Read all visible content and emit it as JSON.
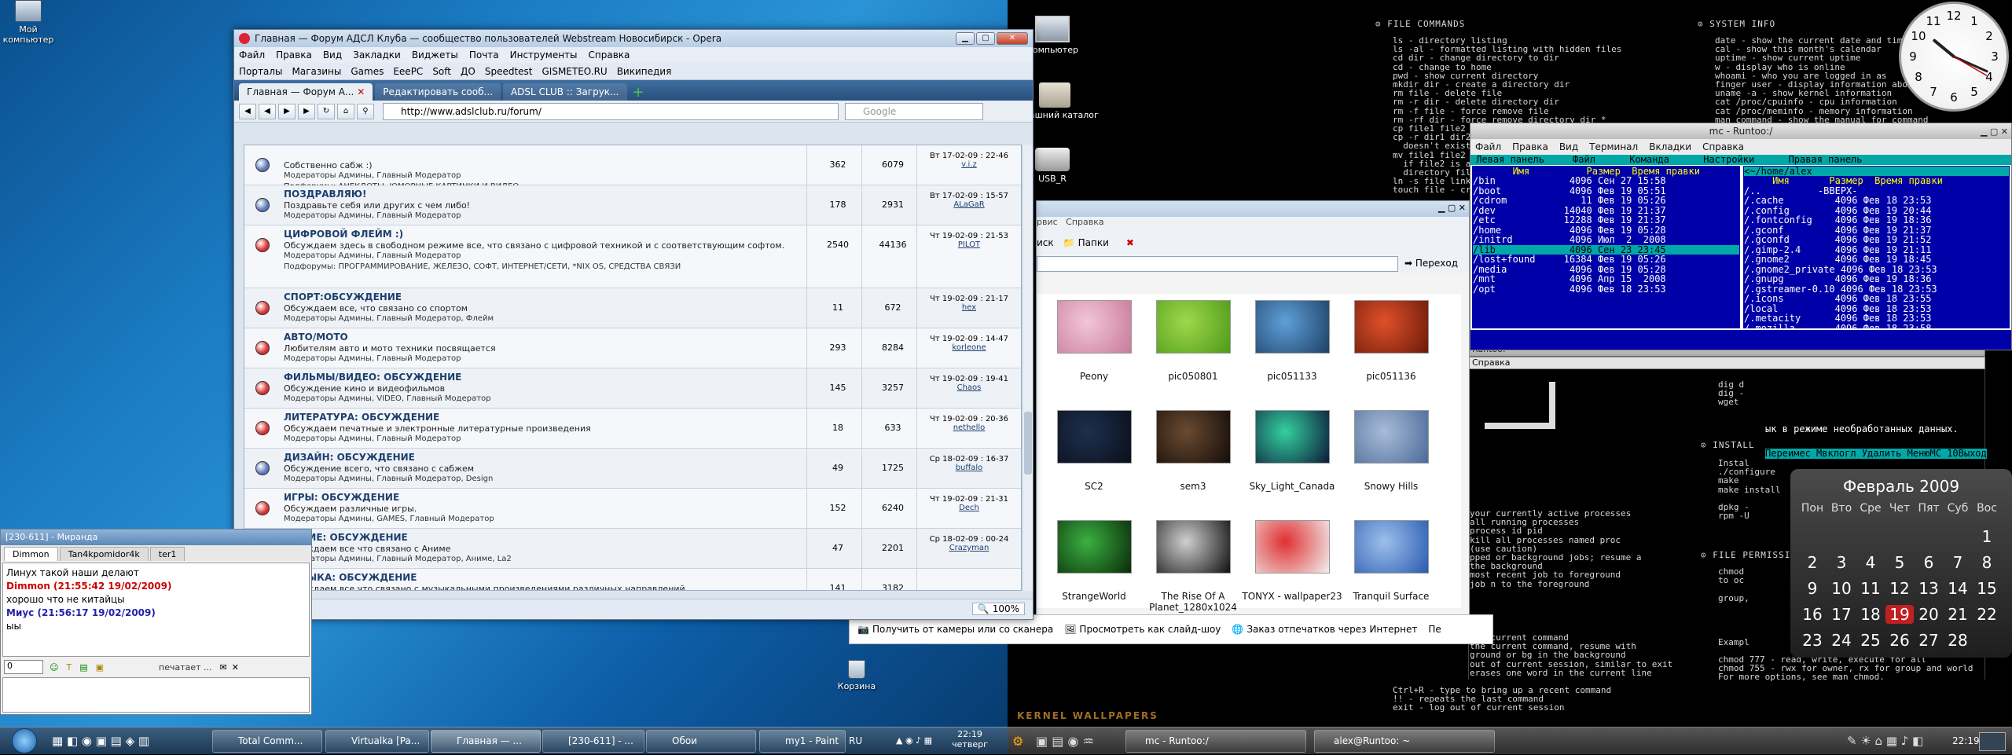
{
  "desktop_left": {
    "icons": [
      {
        "label": "Мой компьютер"
      },
      {
        "label": "Корзина"
      }
    ]
  },
  "desktop_right": {
    "icons": [
      {
        "label": "Компьютер"
      },
      {
        "label": "Домашний каталог"
      },
      {
        "label": "USB_R"
      }
    ],
    "file_commands_header": "FILE COMMANDS",
    "system_info_header": "SYSTEM INFO",
    "install_header": "INSTALL",
    "file_perm_header": "FILE PERMISSIONS",
    "file_commands": "ls - directory listing\nls -al - formatted listing with hidden files\ncd dir - change directory to dir\ncd - change to home\npwd - show current directory\nmkdir dir - create a directory dir\nrm file - delete file\nrm -r dir - delete directory dir\nrm -f file - force remove file\nrm -rf dir - force remove directory dir *\ncp file1 file2 - copy file1 to file2\ncp -r dir1 dir2 - copy dir1 to dir2; create dir2 if it\n  doesn't exist\nmv file1 file2 - rename or move file1 to file2\n  if file2 is an existing directory, moves file1 into\n  directory file2\nln -s file link - create symbolic link link to file\ntouch file - create or update file",
    "system_info": "date - show the current date and time\ncal - show this month's calendar\nuptime - show current uptime\nw - display who is online\nwhoami - who you are logged in as\nfinger user - display information about user\nuname -a - show kernel information\ncat /proc/cpuinfo - cpu information\ncat /proc/meminfo - memory information\nman command - show the manual for command",
    "bottom_text": "Ctrl+R - type to bring up a recent command\n!! - repeats the last command\nexit - log out of current session",
    "mid_text": "your currently active processes\nall running processes\nprocess id pid\nkill all processes named proc\n(use caution)\npped or background jobs; resume a\nthe background\nmost recent job to foreground\njob n to the foreground",
    "mid2_text": "the current command\nthe current command, resume with\nground or bg in the background\nout of current session, similar to exit\nerases one word in the current line",
    "perm_text": "chmod\nto oc\n\ngroup,\n\n\n\n\nExampl\n\nchmod 777 - read, write, execute for all\nchmod 755 - rwx for owner, rx for group and world\nFor more options, see man chmod.",
    "install_text": "Instal\n./configure\nmake\nmake install\n\ndpkg -\nrpm -U",
    "pkg_text": "dig d\ndig -\nwget"
  },
  "opera": {
    "title": "Главная — Форум АДСЛ Клуба — сообщество пользователей Webstream Новосибирск - Opera",
    "menu": [
      "Файл",
      "Правка",
      "Вид",
      "Закладки",
      "Виджеты",
      "Почта",
      "Инструменты",
      "Справка"
    ],
    "bookmarks": [
      "Порталы",
      "Магазины",
      "Games",
      "EeePC",
      "Soft",
      "ДО",
      "Speedtest",
      "GISMETEO.RU",
      "Википедия"
    ],
    "tabs": [
      "Главная — Форум А...",
      "Редактировать сооб...",
      "ADSL CLUB :: Загрук..."
    ],
    "url": "http://www.adslclub.ru/forum/",
    "search_placeholder": "Google",
    "zoom": "100%",
    "forums": [
      {
        "title": "",
        "desc": "Собственно сабж :)",
        "mods": "Модераторы Админы, Главный Модератор",
        "sub": "Подфорумы:  АНЕКДОТЫ,  ЮМОРНЫЕ КАРТИНКИ И ВИДЕО",
        "topics": "362",
        "posts": "6079",
        "date": "Вт 17-02-09 : 22-46",
        "user": "v.i.z",
        "color": "#5878b8"
      },
      {
        "title": "ПОЗДРАВЛЯЮ!",
        "desc": "Поздравьте себя или других с чем либо!",
        "mods": "Модераторы Админы, Главный Модератор",
        "sub": "",
        "topics": "178",
        "posts": "2931",
        "date": "Вт 17-02-09 : 15-57",
        "user": "ALaGaR",
        "color": "#5878b8"
      },
      {
        "title": "ЦИФРОВОЙ ФЛЕЙМ :)",
        "desc": "Обсуждаем здесь в свободном режиме все, что связано с цифровой техникой и с соответствующим софтом.",
        "mods": "Модераторы Админы, Главный Модератор",
        "sub": "Подфорумы:  ПРОГРАММИРОВАНИЕ,  ЖЕЛЕЗО,  СОФТ,  ИНТЕРНЕТ/СЕТИ,  *NIX OS,  СРЕДСТВА СВЯЗИ",
        "topics": "2540",
        "posts": "44136",
        "date": "Чт 19-02-09 : 21-53",
        "user": "PILOT",
        "color": "#d83030"
      },
      {
        "title": "СПОРТ:ОБСУЖДЕНИЕ",
        "desc": "Обсуждаем все, что связано со спортом",
        "mods": "Модераторы Админы, Главный Модератор, Флейм",
        "sub": "",
        "topics": "11",
        "posts": "672",
        "date": "Чт 19-02-09 : 21-17",
        "user": "hex",
        "color": "#d83030"
      },
      {
        "title": "АВТО/МОТО",
        "desc": "Любителям авто и мото техники посвящается",
        "mods": "Модераторы Админы, Главный Модератор",
        "sub": "",
        "topics": "293",
        "posts": "8284",
        "date": "Чт 19-02-09 : 14-47",
        "user": "korleone",
        "color": "#d83030"
      },
      {
        "title": "ФИЛЬМЫ/ВИДЕО: ОБСУЖДЕНИЕ",
        "desc": "Обсуждение кино и видеофильмов",
        "mods": "Модераторы Админы, VIDEO, Главный Модератор",
        "sub": "",
        "topics": "145",
        "posts": "3257",
        "date": "Чт 19-02-09 : 19-41",
        "user": "Chaos",
        "color": "#d83030"
      },
      {
        "title": "ЛИТЕРАТУРА: ОБСУЖДЕНИЕ",
        "desc": "Обсуждаем печатные и электронные литературные произведения",
        "mods": "Модераторы Админы, Главный Модератор",
        "sub": "",
        "topics": "18",
        "posts": "633",
        "date": "Чт 19-02-09 : 20-36",
        "user": "nethello",
        "color": "#d83030"
      },
      {
        "title": "ДИЗАЙН: ОБСУЖДЕНИЕ",
        "desc": "Обсуждение всего, что связано с сабжем",
        "mods": "Модераторы Админы, Главный Модератор, Design",
        "sub": "",
        "topics": "49",
        "posts": "1725",
        "date": "Ср 18-02-09 : 16-37",
        "user": "buffalo",
        "color": "#5878b8"
      },
      {
        "title": "ИГРЫ: ОБСУЖДЕНИЕ",
        "desc": "Обсуждаем различные игры.",
        "mods": "Модераторы Админы, GAMES, Главный Модератор",
        "sub": "",
        "topics": "152",
        "posts": "6240",
        "date": "Чт 19-02-09 : 21-31",
        "user": "Dech",
        "color": "#d83030"
      },
      {
        "title": "АНИМЕ: ОБСУЖДЕНИЕ",
        "desc": "Обсуждаем все что связано с Аниме",
        "mods": "Модераторы Админы, Главный Модератор, Аниме, La2",
        "sub": "",
        "topics": "47",
        "posts": "2201",
        "date": "Ср 18-02-09 : 00-24",
        "user": "Crazyman",
        "color": "#5878b8"
      },
      {
        "title": "МУЗЫКА: ОБСУЖДЕНИЕ",
        "desc": "Обсуждаем все что связано с музыкальными произведениями различных направлений",
        "mods": "",
        "sub": "",
        "topics": "141",
        "posts": "3182",
        "date": "",
        "user": "",
        "color": "#d83030"
      }
    ]
  },
  "chat": {
    "title": "[230-611] - Mиранда",
    "tabs": [
      "Dimmon",
      "Tan4kpomidor4k",
      "ter1"
    ],
    "messages": [
      {
        "text": "Линух такой наши делают",
        "cls": "plain"
      },
      {
        "text": "Dimmon (21:55:42 19/02/2009)",
        "cls": "red"
      },
      {
        "text": "хорошо что не китайцы",
        "cls": "plain"
      },
      {
        "text": "Миус (21:56:17 19/02/2009)",
        "cls": "blue"
      },
      {
        "text": "ыы",
        "cls": "plain"
      }
    ],
    "input_value": "0",
    "typing": "печатает ..."
  },
  "explorer": {
    "menu_a": "рвис",
    "menu_b": "Справка",
    "toolbar_search": "иск",
    "toolbar_folders": "Папки",
    "go": "Переход",
    "thumbs": [
      {
        "label": "Peony",
        "c1": "#f3c6d6",
        "c2": "#c77a9a"
      },
      {
        "label": "pic050801",
        "c1": "#9ed84a",
        "c2": "#4e9a1a"
      },
      {
        "label": "pic051133",
        "c1": "#5fa0d8",
        "c2": "#1e3f66"
      },
      {
        "label": "pic051136",
        "c1": "#e0502a",
        "c2": "#6a1a0a"
      },
      {
        "label": "SC2",
        "c1": "#1d2f4e",
        "c2": "#0a0f1a"
      },
      {
        "label": "sem3",
        "c1": "#6a4a30",
        "c2": "#140c08"
      },
      {
        "label": "Sky_Light_Canada",
        "c1": "#34d0a0",
        "c2": "#0c1a38"
      },
      {
        "label": "Snowy Hills",
        "c1": "#a8bcd8",
        "c2": "#4a6a98"
      },
      {
        "label": "StrangeWorld",
        "c1": "#3ab040",
        "c2": "#0a2a0a"
      },
      {
        "label": "The Rise Of A Planet_1280x1024",
        "c1": "#cfcfcf",
        "c2": "#101010"
      },
      {
        "label": "TONYX - wallpaper23",
        "c1": "#e03030",
        "c2": "#f0f0f0"
      },
      {
        "label": "Tranquil Surface",
        "c1": "#9cc0ec",
        "c2": "#2a5ab0"
      }
    ],
    "tasks": [
      "Получить от камеры или со сканера",
      "Просмотреть как слайд-шоу",
      "Заказ отпечатков через Интернет",
      "Пе"
    ]
  },
  "mc": {
    "title": "mc - Runtoo:/",
    "menu": [
      "Файл",
      "Правка",
      "Вид",
      "Терминал",
      "Вкладки",
      "Справка"
    ],
    "topbar": " Левая панель     Файл      Команда      Настройки      Правая панель",
    "left_path": "",
    "right_path": "<~/home/alex",
    "left_head": "       Имя          Размер  Время правки",
    "right_head": "     Имя       Размер  Время правки",
    "left_rows": [
      "/bin             4096 Сен 27 15:58",
      "/boot            4096 Фев 19 05:51",
      "/cdrom             11 Фев 19 05:26",
      "/dev            14040 Фев 19 21:37",
      "/etc            12288 Фев 19 21:37",
      "/home            4096 Фев 19 05:28",
      "/initrd          4096 Июл  2  2008",
      "/lib             4096 Сен 23 23:45",
      "/lost+found     16384 Фев 19 05:26",
      "/media           4096 Фев 19 05:28",
      "/mnt             4096 Апр 15  2008",
      "/opt             4096 Фев 18 23:53"
    ],
    "right_rows": [
      "/..          -ВВЕРХ-",
      "/.cache         4096 Фев 18 23:53",
      "/.config        4096 Фев 19 20:44",
      "/.fontconfig    4096 Фев 19 18:36",
      "/.gconf         4096 Фев 19 21:37",
      "/.gconfd        4096 Фев 19 21:52",
      "/.gimp-2.4      4096 Фев 19 21:11",
      "/.gnome2        4096 Фев 19 18:45",
      "/.gnome2_private 4096 Фев 18 23:53",
      "/.gnupg         4096 Фев 19 18:36",
      "/.gstreamer-0.10 4096 Фев 18 23:53",
      "/.icons         4096 Фев 18 23:55",
      "/local          4096 Фев 18 23:53",
      "/.metacity      4096 Фев 18 23:53",
      "/.mozilla       4096 Фев 18 23:58"
    ],
    "status": "ык в режиме необработанных данных.",
    "fkeys": "Переимес Мвклогл Удалить МенюМС 10Выход"
  },
  "terminal": {
    "title": "Runtoo: ~",
    "menu": "Справка"
  },
  "calendar": {
    "month": "Февраль 2009",
    "days_header": [
      "Пон",
      "Вто",
      "Сре",
      "Чет",
      "Пят",
      "Суб",
      "Вос"
    ],
    "weeks": [
      [
        "",
        "",
        "",
        "",
        "",
        "",
        "1"
      ],
      [
        "2",
        "3",
        "4",
        "5",
        "6",
        "7",
        "8"
      ],
      [
        "9",
        "10",
        "11",
        "12",
        "13",
        "14",
        "15"
      ],
      [
        "16",
        "17",
        "18",
        "19",
        "20",
        "21",
        "22"
      ],
      [
        "23",
        "24",
        "25",
        "26",
        "27",
        "28",
        ""
      ]
    ],
    "today": "19"
  },
  "clock": {
    "numbers": [
      "12",
      "1",
      "2",
      "3",
      "4",
      "5",
      "6",
      "7",
      "8",
      "9",
      "10",
      "11"
    ],
    "hour": 22,
    "minute": 19
  },
  "taskbar_win": {
    "items": [
      "",
      "Total Comm...",
      "Virtualka [Pa...",
      "Главная — ...",
      "[230-611] - ...",
      "Обои",
      "my1 - Paint"
    ],
    "lang": "RU",
    "time": "22:19",
    "day": "четверг"
  },
  "taskbar_linux": {
    "items": [
      "mc - Runtoo:/",
      "alex@Runtoo: ~"
    ],
    "time": "22:19",
    "brand": "KERNEL WALLPAPERS"
  }
}
